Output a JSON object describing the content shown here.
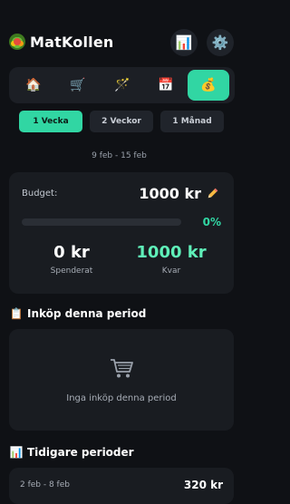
{
  "app": {
    "title": "MatKollen",
    "logo_icon": "salad-bowl-icon"
  },
  "header": {
    "stats_icon": "bar-chart-icon",
    "settings_icon": "gear-icon"
  },
  "tabs": [
    {
      "icon": "home-icon",
      "glyph": "🏠",
      "active": false
    },
    {
      "icon": "shopping-cart-icon",
      "glyph": "🛒",
      "active": false
    },
    {
      "icon": "wand-icon",
      "glyph": "🪄",
      "active": false
    },
    {
      "icon": "calendar-icon",
      "glyph": "📅",
      "active": false
    },
    {
      "icon": "money-bag-icon",
      "glyph": "💰",
      "active": true
    }
  ],
  "period": {
    "options": [
      "1 Vecka",
      "2 Veckor",
      "1 Månad"
    ],
    "selected": "1 Vecka",
    "date_range": "9 feb - 15 feb"
  },
  "budget": {
    "label": "Budget:",
    "amount": "1000 kr",
    "edit_icon": "pencil-icon",
    "progress_percent": 0,
    "progress_text": "0%",
    "spent_value": "0 kr",
    "spent_label": "Spenderat",
    "left_value": "1000 kr",
    "left_label": "Kvar"
  },
  "purchases": {
    "title": "Inköp denna period",
    "icon": "clipboard-icon",
    "empty_icon": "shopping-cart-icon",
    "empty_text": "Inga inköp denna period"
  },
  "history": {
    "title": "Tidigare perioder",
    "icon": "bar-chart-icon",
    "items": [
      {
        "date": "2 feb - 8 feb",
        "amount": "320 kr"
      }
    ]
  },
  "colors": {
    "accent": "#31d6a3",
    "background": "#0f1115",
    "card": "#191c21"
  }
}
